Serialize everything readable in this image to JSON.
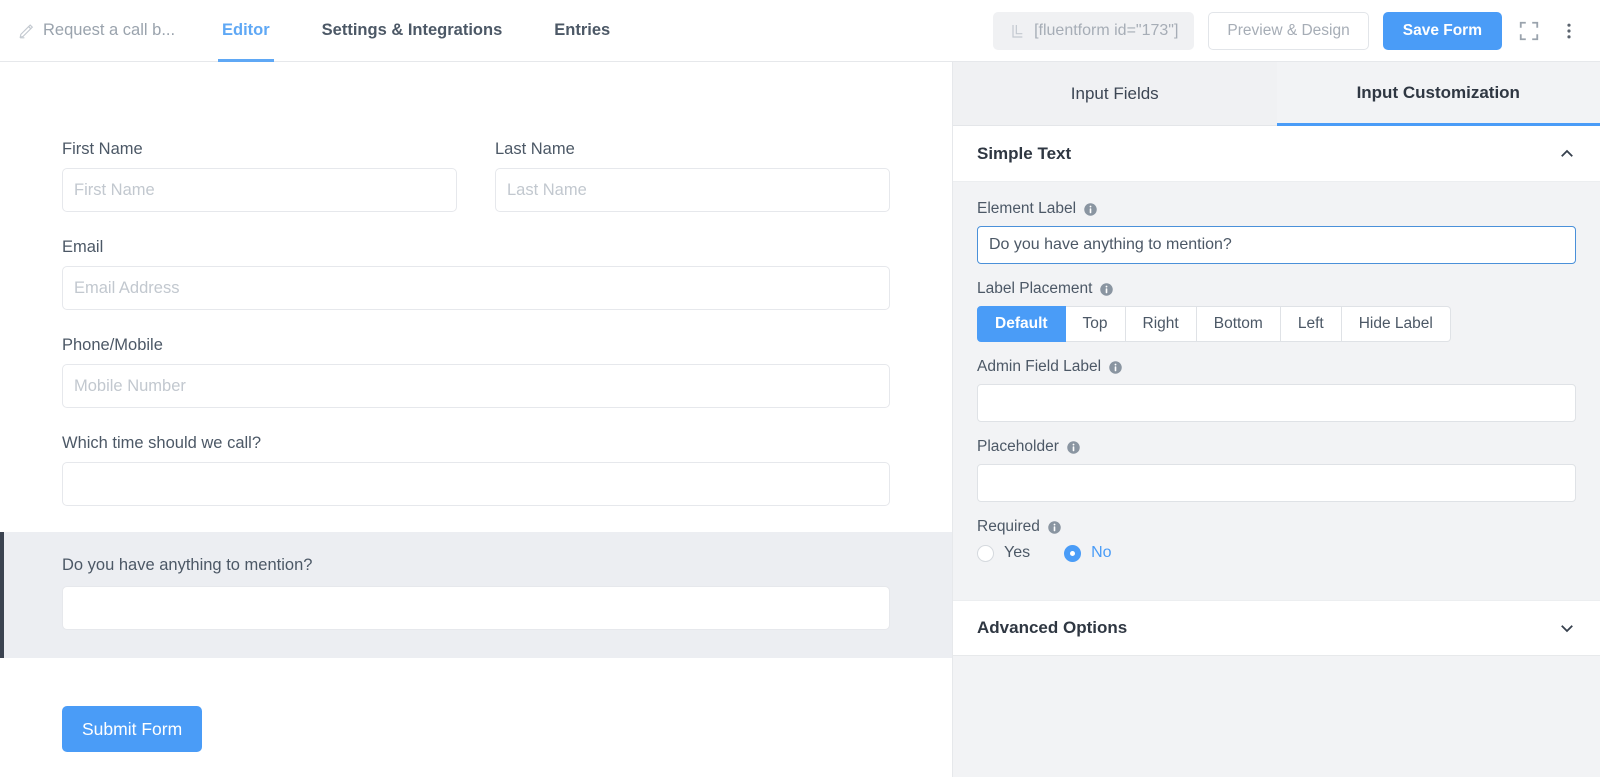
{
  "header": {
    "form_title": "Request a call b...",
    "pencil_icon": "pencil-icon",
    "tabs": [
      {
        "label": "Editor",
        "active": true
      },
      {
        "label": "Settings & Integrations",
        "active": false
      },
      {
        "label": "Entries",
        "active": false
      }
    ],
    "shortcode": "[fluentform id=\"173\"]",
    "shortcode_icon": "shortcode-icon",
    "preview_button": "Preview & Design",
    "save_button": "Save Form",
    "fullscreen_icon": "fullscreen-icon",
    "more_icon": "more-vertical-icon",
    "accent_color": "#4a9cf7",
    "active_tab_color": "#5fa8f5"
  },
  "form": {
    "fields": [
      {
        "label": "First Name",
        "placeholder": "First Name",
        "value": ""
      },
      {
        "label": "Last Name",
        "placeholder": "Last Name",
        "value": ""
      },
      {
        "label": "Email",
        "placeholder": "Email Address",
        "value": ""
      },
      {
        "label": "Phone/Mobile",
        "placeholder": "Mobile Number",
        "value": ""
      },
      {
        "label": "Which time should we call?",
        "placeholder": "",
        "value": ""
      },
      {
        "label": "Do you have anything to mention?",
        "placeholder": "",
        "value": "",
        "selected": true
      }
    ],
    "submit_label": "Submit Form",
    "selected_accent": "#3b4350",
    "selected_bg": "#eceef2"
  },
  "panel": {
    "tabs": [
      {
        "label": "Input Fields",
        "active": false
      },
      {
        "label": "Input Customization",
        "active": true
      }
    ],
    "section": {
      "title": "Simple Text",
      "collapse_icon": "chevron-up-icon"
    },
    "settings": {
      "element_label": {
        "label": "Element Label",
        "value": "Do you have anything to mention?",
        "placeholder": "",
        "info_icon": "info-icon"
      },
      "label_placement": {
        "label": "Label Placement",
        "info_icon": "info-icon",
        "options": [
          "Default",
          "Top",
          "Right",
          "Bottom",
          "Left",
          "Hide Label"
        ],
        "selected": "Default"
      },
      "admin_field_label": {
        "label": "Admin Field Label",
        "value": "",
        "placeholder": "",
        "info_icon": "info-icon"
      },
      "placeholder_setting": {
        "label": "Placeholder",
        "value": "",
        "placeholder": "",
        "info_icon": "info-icon"
      },
      "required": {
        "label": "Required",
        "info_icon": "info-icon",
        "options": [
          "Yes",
          "No"
        ],
        "selected": "No"
      }
    },
    "advanced": {
      "title": "Advanced Options",
      "expand_icon": "chevron-down-icon"
    }
  }
}
